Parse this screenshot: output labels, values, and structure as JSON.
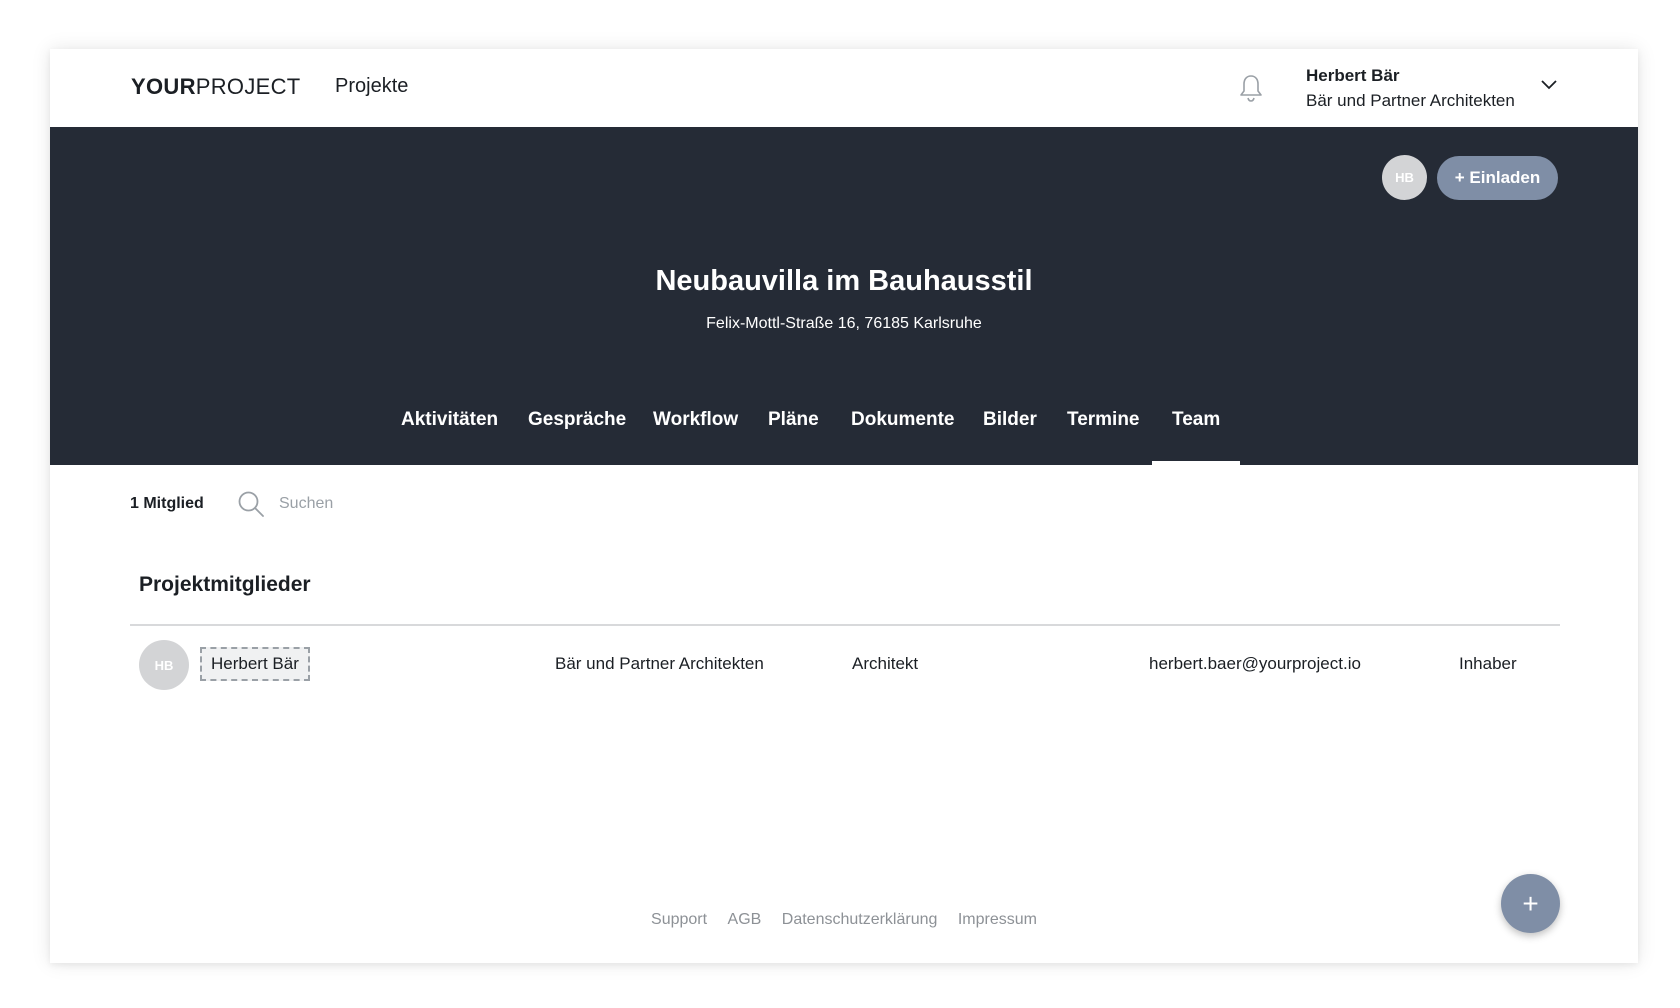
{
  "header": {
    "logo_bold": "YOUR",
    "logo_light": "PROJECT",
    "nav_projects": "Projekte",
    "user_name": "Herbert Bär",
    "user_company": "Bär und Partner Architekten"
  },
  "project": {
    "owner_initials": "HB",
    "invite_label": "+ Einladen",
    "title": "Neubauvilla im Bauhausstil",
    "address": "Felix-Mottl-Straße 16, 76185 Karlsruhe",
    "tabs": [
      {
        "label": "Aktivitäten"
      },
      {
        "label": "Gespräche"
      },
      {
        "label": "Workflow"
      },
      {
        "label": "Pläne"
      },
      {
        "label": "Dokumente"
      },
      {
        "label": "Bilder"
      },
      {
        "label": "Termine"
      },
      {
        "label": "Team"
      }
    ],
    "active_tab": "Team"
  },
  "team": {
    "member_count": "1 Mitglied",
    "search_placeholder": "Suchen",
    "section_title": "Projektmitglieder",
    "members": [
      {
        "initials": "HB",
        "name": "Herbert Bär",
        "company": "Bär und Partner Architekten",
        "role": "Architekt",
        "email": "herbert.baer@yourproject.io",
        "permission": "Inhaber"
      }
    ]
  },
  "footer": {
    "links": [
      "Support",
      "AGB",
      "Datenschutzerklärung",
      "Impressum"
    ]
  },
  "fab_label": "+",
  "colors": {
    "hero_bg": "#252b36",
    "accent": "#7f8ea6",
    "avatar_bg": "#d3d4d6"
  }
}
